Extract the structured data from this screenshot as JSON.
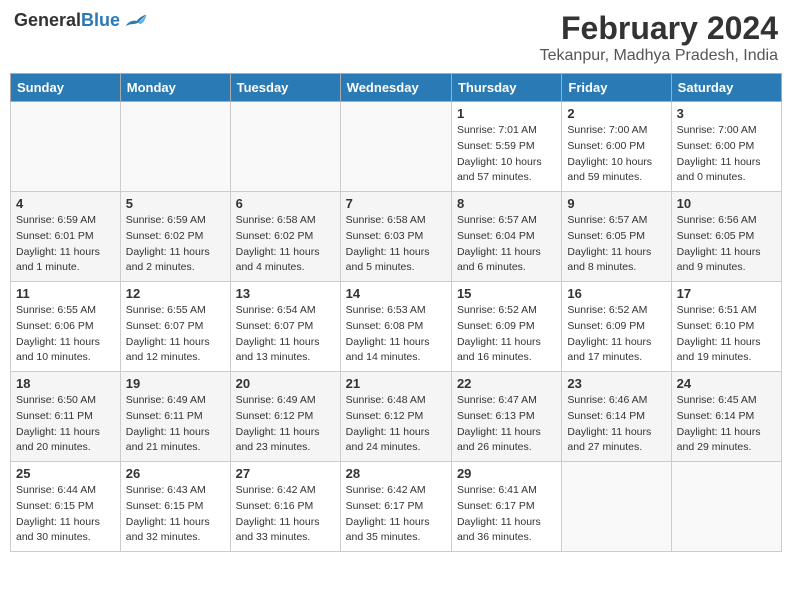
{
  "logo": {
    "general": "General",
    "blue": "Blue"
  },
  "header": {
    "month_year": "February 2024",
    "location": "Tekanpur, Madhya Pradesh, India"
  },
  "weekdays": [
    "Sunday",
    "Monday",
    "Tuesday",
    "Wednesday",
    "Thursday",
    "Friday",
    "Saturday"
  ],
  "weeks": [
    [
      {
        "day": "",
        "sunrise": "",
        "sunset": "",
        "daylight": ""
      },
      {
        "day": "",
        "sunrise": "",
        "sunset": "",
        "daylight": ""
      },
      {
        "day": "",
        "sunrise": "",
        "sunset": "",
        "daylight": ""
      },
      {
        "day": "",
        "sunrise": "",
        "sunset": "",
        "daylight": ""
      },
      {
        "day": "1",
        "sunrise": "Sunrise: 7:01 AM",
        "sunset": "Sunset: 5:59 PM",
        "daylight": "Daylight: 10 hours and 57 minutes."
      },
      {
        "day": "2",
        "sunrise": "Sunrise: 7:00 AM",
        "sunset": "Sunset: 6:00 PM",
        "daylight": "Daylight: 10 hours and 59 minutes."
      },
      {
        "day": "3",
        "sunrise": "Sunrise: 7:00 AM",
        "sunset": "Sunset: 6:00 PM",
        "daylight": "Daylight: 11 hours and 0 minutes."
      }
    ],
    [
      {
        "day": "4",
        "sunrise": "Sunrise: 6:59 AM",
        "sunset": "Sunset: 6:01 PM",
        "daylight": "Daylight: 11 hours and 1 minute."
      },
      {
        "day": "5",
        "sunrise": "Sunrise: 6:59 AM",
        "sunset": "Sunset: 6:02 PM",
        "daylight": "Daylight: 11 hours and 2 minutes."
      },
      {
        "day": "6",
        "sunrise": "Sunrise: 6:58 AM",
        "sunset": "Sunset: 6:02 PM",
        "daylight": "Daylight: 11 hours and 4 minutes."
      },
      {
        "day": "7",
        "sunrise": "Sunrise: 6:58 AM",
        "sunset": "Sunset: 6:03 PM",
        "daylight": "Daylight: 11 hours and 5 minutes."
      },
      {
        "day": "8",
        "sunrise": "Sunrise: 6:57 AM",
        "sunset": "Sunset: 6:04 PM",
        "daylight": "Daylight: 11 hours and 6 minutes."
      },
      {
        "day": "9",
        "sunrise": "Sunrise: 6:57 AM",
        "sunset": "Sunset: 6:05 PM",
        "daylight": "Daylight: 11 hours and 8 minutes."
      },
      {
        "day": "10",
        "sunrise": "Sunrise: 6:56 AM",
        "sunset": "Sunset: 6:05 PM",
        "daylight": "Daylight: 11 hours and 9 minutes."
      }
    ],
    [
      {
        "day": "11",
        "sunrise": "Sunrise: 6:55 AM",
        "sunset": "Sunset: 6:06 PM",
        "daylight": "Daylight: 11 hours and 10 minutes."
      },
      {
        "day": "12",
        "sunrise": "Sunrise: 6:55 AM",
        "sunset": "Sunset: 6:07 PM",
        "daylight": "Daylight: 11 hours and 12 minutes."
      },
      {
        "day": "13",
        "sunrise": "Sunrise: 6:54 AM",
        "sunset": "Sunset: 6:07 PM",
        "daylight": "Daylight: 11 hours and 13 minutes."
      },
      {
        "day": "14",
        "sunrise": "Sunrise: 6:53 AM",
        "sunset": "Sunset: 6:08 PM",
        "daylight": "Daylight: 11 hours and 14 minutes."
      },
      {
        "day": "15",
        "sunrise": "Sunrise: 6:52 AM",
        "sunset": "Sunset: 6:09 PM",
        "daylight": "Daylight: 11 hours and 16 minutes."
      },
      {
        "day": "16",
        "sunrise": "Sunrise: 6:52 AM",
        "sunset": "Sunset: 6:09 PM",
        "daylight": "Daylight: 11 hours and 17 minutes."
      },
      {
        "day": "17",
        "sunrise": "Sunrise: 6:51 AM",
        "sunset": "Sunset: 6:10 PM",
        "daylight": "Daylight: 11 hours and 19 minutes."
      }
    ],
    [
      {
        "day": "18",
        "sunrise": "Sunrise: 6:50 AM",
        "sunset": "Sunset: 6:11 PM",
        "daylight": "Daylight: 11 hours and 20 minutes."
      },
      {
        "day": "19",
        "sunrise": "Sunrise: 6:49 AM",
        "sunset": "Sunset: 6:11 PM",
        "daylight": "Daylight: 11 hours and 21 minutes."
      },
      {
        "day": "20",
        "sunrise": "Sunrise: 6:49 AM",
        "sunset": "Sunset: 6:12 PM",
        "daylight": "Daylight: 11 hours and 23 minutes."
      },
      {
        "day": "21",
        "sunrise": "Sunrise: 6:48 AM",
        "sunset": "Sunset: 6:12 PM",
        "daylight": "Daylight: 11 hours and 24 minutes."
      },
      {
        "day": "22",
        "sunrise": "Sunrise: 6:47 AM",
        "sunset": "Sunset: 6:13 PM",
        "daylight": "Daylight: 11 hours and 26 minutes."
      },
      {
        "day": "23",
        "sunrise": "Sunrise: 6:46 AM",
        "sunset": "Sunset: 6:14 PM",
        "daylight": "Daylight: 11 hours and 27 minutes."
      },
      {
        "day": "24",
        "sunrise": "Sunrise: 6:45 AM",
        "sunset": "Sunset: 6:14 PM",
        "daylight": "Daylight: 11 hours and 29 minutes."
      }
    ],
    [
      {
        "day": "25",
        "sunrise": "Sunrise: 6:44 AM",
        "sunset": "Sunset: 6:15 PM",
        "daylight": "Daylight: 11 hours and 30 minutes."
      },
      {
        "day": "26",
        "sunrise": "Sunrise: 6:43 AM",
        "sunset": "Sunset: 6:15 PM",
        "daylight": "Daylight: 11 hours and 32 minutes."
      },
      {
        "day": "27",
        "sunrise": "Sunrise: 6:42 AM",
        "sunset": "Sunset: 6:16 PM",
        "daylight": "Daylight: 11 hours and 33 minutes."
      },
      {
        "day": "28",
        "sunrise": "Sunrise: 6:42 AM",
        "sunset": "Sunset: 6:17 PM",
        "daylight": "Daylight: 11 hours and 35 minutes."
      },
      {
        "day": "29",
        "sunrise": "Sunrise: 6:41 AM",
        "sunset": "Sunset: 6:17 PM",
        "daylight": "Daylight: 11 hours and 36 minutes."
      },
      {
        "day": "",
        "sunrise": "",
        "sunset": "",
        "daylight": ""
      },
      {
        "day": "",
        "sunrise": "",
        "sunset": "",
        "daylight": ""
      }
    ]
  ]
}
